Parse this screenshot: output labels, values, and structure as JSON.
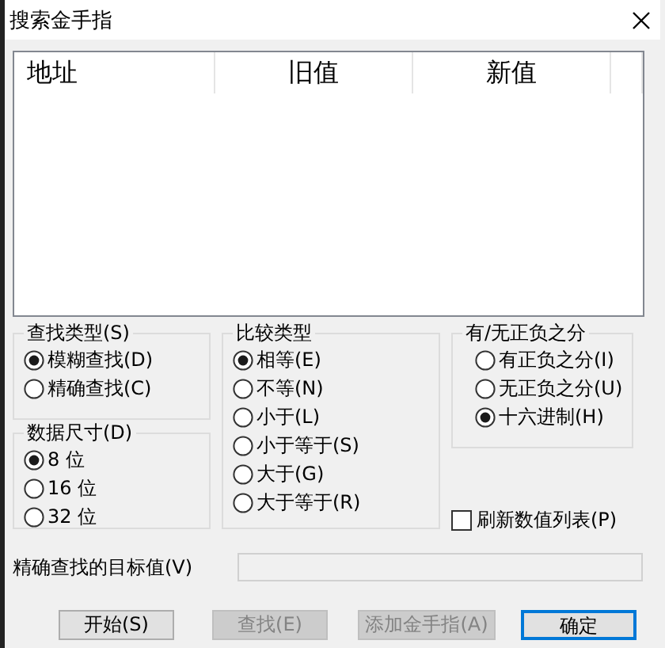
{
  "window": {
    "title": "搜索金手指"
  },
  "list": {
    "columns": [
      "地址",
      "旧值",
      "新值"
    ]
  },
  "search_type": {
    "label": "查找类型(S)",
    "options": [
      {
        "label": "模糊查找(D)",
        "selected": true
      },
      {
        "label": "精确查找(C)",
        "selected": false
      }
    ]
  },
  "data_size": {
    "label": "数据尺寸(D)",
    "options": [
      {
        "label": "8 位",
        "selected": true
      },
      {
        "label": "16 位",
        "selected": false
      },
      {
        "label": "32 位",
        "selected": false
      }
    ]
  },
  "compare_type": {
    "label": "比较类型",
    "options": [
      {
        "label": "相等(E)",
        "selected": true
      },
      {
        "label": "不等(N)",
        "selected": false
      },
      {
        "label": "小于(L)",
        "selected": false
      },
      {
        "label": "小于等于(S)",
        "selected": false
      },
      {
        "label": "大于(G)",
        "selected": false
      },
      {
        "label": "大于等于(R)",
        "selected": false
      }
    ]
  },
  "sign": {
    "label": "有/无正负之分",
    "options": [
      {
        "label": "有正负之分(I)",
        "selected": false
      },
      {
        "label": "无正负之分(U)",
        "selected": false
      },
      {
        "label": "十六进制(H)",
        "selected": true
      }
    ]
  },
  "refresh_list": {
    "label": "刷新数值列表(P)",
    "checked": false
  },
  "target_value": {
    "label": "精确查找的目标值(V)",
    "disabled": true
  },
  "buttons": [
    {
      "label": "开始(S)",
      "disabled": false,
      "default": false
    },
    {
      "label": "查找(E)",
      "disabled": true,
      "default": false
    },
    {
      "label": "添加金手指(A)",
      "disabled": true,
      "default": false
    },
    {
      "label": "确定",
      "disabled": false,
      "default": true
    }
  ]
}
